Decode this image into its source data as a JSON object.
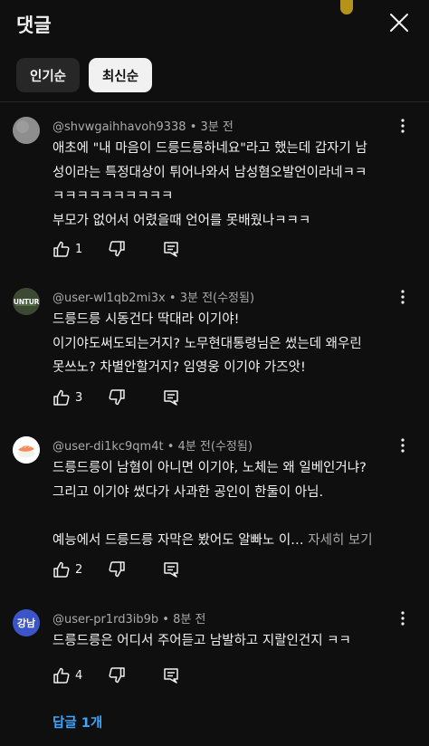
{
  "header": {
    "title": "댓글"
  },
  "sort_chips": [
    {
      "label": "인기순",
      "selected": false
    },
    {
      "label": "최신순",
      "selected": true
    }
  ],
  "comments": [
    {
      "author": "@shvwgaihhavoh9338",
      "time": "3분 전",
      "avatar": {
        "icon": "gray-circle-avatar",
        "color": "#8a8a8a"
      },
      "lines": [
        "애초에 \"내 마음이 드릉드릉하네요\"라고 했는데 갑자기 남",
        "성이라는 특정대상이 튀어나와서 남성혐오발언이라네ㅋㅋ",
        "ㅋㅋㅋㅋㅋㅋㅋㅋㅋㅋ",
        "부모가 없어서 어렸을때 언어를 못배웠나ㅋㅋㅋ"
      ],
      "likes": "1"
    },
    {
      "author": "@user-wl1qb2mi3x",
      "time": "3분 전(수정됨)",
      "avatar": {
        "icon": "untur-logo-avatar",
        "text": "UNTUR"
      },
      "lines": [
        "드릉드릉 시동건다 딱대라 이기야!",
        "이기야도써도되는거지? 노무현대통령님은 썼는데 왜우린",
        "못쓰노? 차별안할거지? 임영웅 이기야 가즈앗!"
      ],
      "likes": "3"
    },
    {
      "author": "@user-di1kc9qm4t",
      "time": "4분 전(수정됨)",
      "avatar": {
        "icon": "sushi-avatar"
      },
      "lines": [
        "드릉드릉이 남혐이 아니면 이기야, 노체는 왜 일베인거냐?",
        "그리고 이기야 썼다가 사과한 공인이 한둘이 아님.",
        "",
        "예능에서 드릉드릉 자막은 봤어도 알빠노 이…"
      ],
      "see_more": "자세히 보기",
      "likes": "2"
    },
    {
      "author": "@user-pr1rd3ib9b",
      "time": "8분 전",
      "avatar": {
        "icon": "gangnam-text-avatar",
        "text": "강남",
        "color": "#3b55c9"
      },
      "lines": [
        "드릉드릉은 어디서 주어듣고 남발하고 지랄인건지 ㅋㅋ"
      ],
      "likes": "4",
      "replies_label": "답글 1개"
    }
  ],
  "icons": {
    "close": "close-icon",
    "like": "thumbs-up-icon",
    "dislike": "thumbs-down-icon",
    "reply": "reply-comment-icon",
    "more": "more-vertical-icon"
  },
  "colors": {
    "background": "#0f0f0f",
    "text": "#f1f1f1",
    "secondary_text": "#aaaaaa",
    "link": "#3ea6ff",
    "chip_inactive": "#272727",
    "chip_active": "#f1f1f1"
  }
}
